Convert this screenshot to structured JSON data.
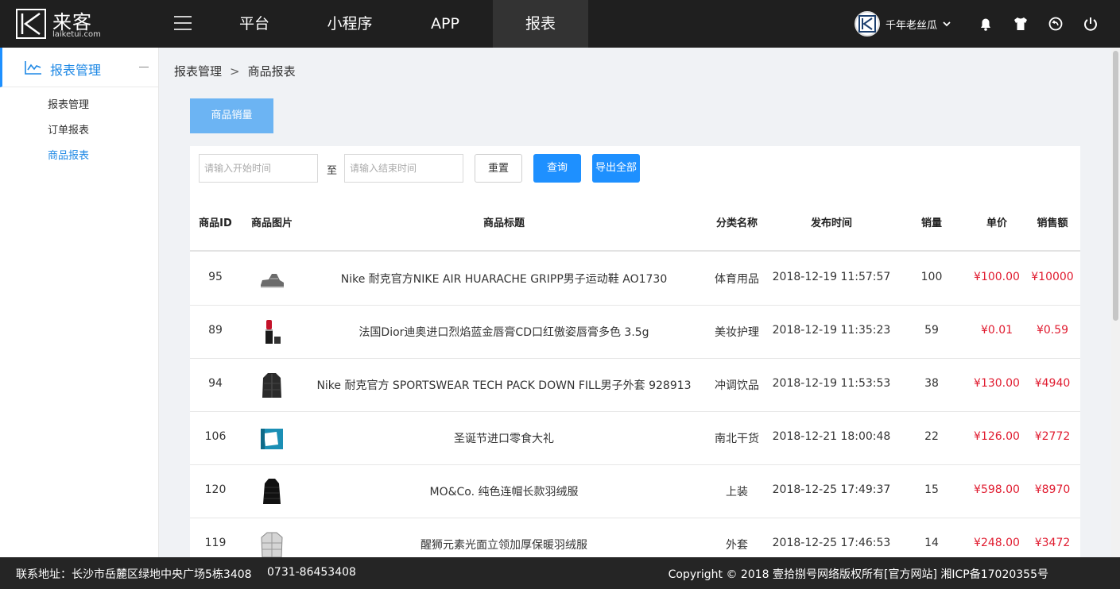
{
  "brand": {
    "name_cn": "来客",
    "name_en": "laiketui.com"
  },
  "nav": {
    "items": [
      "平台",
      "小程序",
      "APP",
      "报表"
    ],
    "active_index": 3
  },
  "user": {
    "name": "千年老丝瓜"
  },
  "sidebar": {
    "group_label": "报表管理",
    "items": [
      {
        "label": "报表管理"
      },
      {
        "label": "订单报表"
      },
      {
        "label": "商品报表"
      }
    ],
    "active_index": 2
  },
  "breadcrumb": {
    "parent": "报表管理",
    "separator": ">",
    "current": "商品报表"
  },
  "tab": {
    "label": "商品销量"
  },
  "filters": {
    "start_placeholder": "请输入开始时间",
    "end_placeholder": "请输入结束时间",
    "to_label": "至",
    "reset_label": "重置",
    "query_label": "查询",
    "export_label": "导出全部"
  },
  "table": {
    "headers": [
      "商品ID",
      "商品图片",
      "商品标题",
      "分类名称",
      "发布时间",
      "销量",
      "单价",
      "销售额"
    ],
    "rows": [
      {
        "id": "95",
        "image": "sneaker-image",
        "title": "Nike 耐克官方NIKE AIR HUARACHE GRIPP男子运动鞋 AO1730",
        "category": "体育用品",
        "date": "2018-12-19 11:57:57",
        "sales": "100",
        "price": "¥100.00",
        "total": "¥10000"
      },
      {
        "id": "89",
        "image": "lipstick-image",
        "title": "法国Dior迪奥进口烈焰蓝金唇膏CD口红傲姿唇膏多色 3.5g",
        "category": "美妆护理",
        "date": "2018-12-19 11:35:23",
        "sales": "59",
        "price": "¥0.01",
        "total": "¥0.59"
      },
      {
        "id": "94",
        "image": "down-jacket-image",
        "title": "Nike 耐克官方 SPORTSWEAR TECH PACK DOWN FILL男子外套 928913",
        "category": "冲调饮品",
        "date": "2018-12-19 11:53:53",
        "sales": "38",
        "price": "¥130.00",
        "total": "¥4940"
      },
      {
        "id": "106",
        "image": "snack-box-image",
        "title": "圣诞节进口零食大礼",
        "category": "南北干货",
        "date": "2018-12-21 18:00:48",
        "sales": "22",
        "price": "¥126.00",
        "total": "¥2772"
      },
      {
        "id": "120",
        "image": "long-coat-image",
        "title": "MO&Co. 纯色连帽长款羽绒服",
        "category": "上装",
        "date": "2018-12-25 17:49:37",
        "sales": "15",
        "price": "¥598.00",
        "total": "¥8970"
      },
      {
        "id": "119",
        "image": "silver-jacket-image",
        "title": "醒狮元素光面立领加厚保暖羽绒服",
        "category": "外套",
        "date": "2018-12-25 17:46:53",
        "sales": "14",
        "price": "¥248.00",
        "total": "¥3472"
      }
    ]
  },
  "footer": {
    "address": "联系地址：长沙市岳麓区绿地中央广场5栋3408",
    "phone": "0731-86453408",
    "copyright": "Copyright © 2018 壹拾捌号网络版权所有[官方网站]  湘ICP备17020355号"
  },
  "colors": {
    "accent": "#1e90ff",
    "price_red": "#e01b2f",
    "topbar": "#1f1f1f",
    "nav_active": "#333333",
    "tab": "#6cb4f3"
  }
}
